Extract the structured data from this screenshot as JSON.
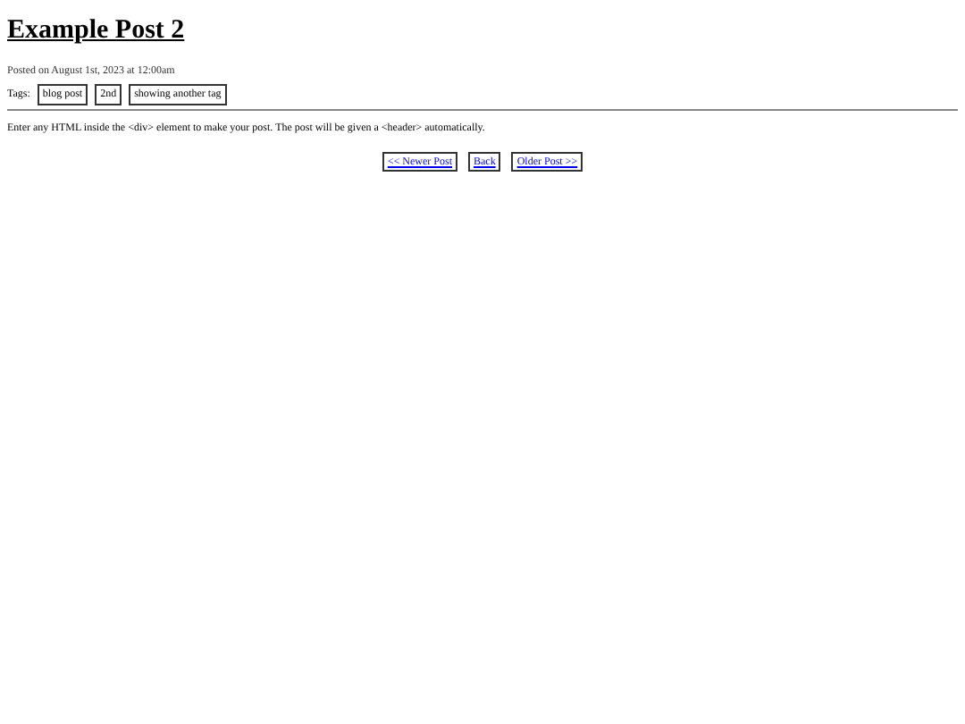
{
  "title": "Example Post 2",
  "posted": "Posted on August 1st, 2023 at 12:00am",
  "tags_label": "Tags:",
  "tags": [
    "blog post",
    "2nd",
    "showing another tag"
  ],
  "body": "Enter any HTML inside the <div> element to make your post. The post will be given a <header> automatically.",
  "nav": [
    "<< Newer Post",
    "Back",
    "Older Post >>"
  ]
}
